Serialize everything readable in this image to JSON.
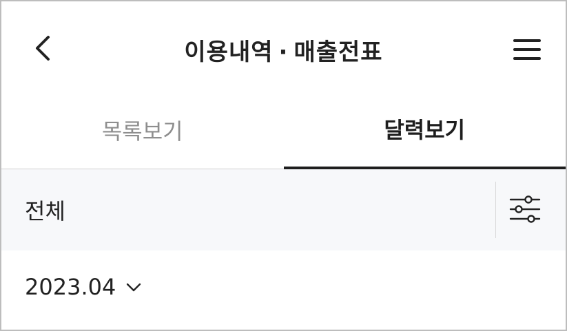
{
  "header": {
    "title_left": "이용내역",
    "title_separator": "·",
    "title_right": "매출전표",
    "back_icon": "chevron-left-icon",
    "menu_icon": "hamburger-menu-icon"
  },
  "tabs": [
    {
      "label": "목록보기",
      "active": false
    },
    {
      "label": "달력보기",
      "active": true
    }
  ],
  "filter": {
    "label": "전체",
    "filter_icon": "sliders-icon"
  },
  "month": {
    "value": "2023.04",
    "icon": "chevron-down-icon"
  },
  "colors": {
    "text": "#222222",
    "inactive_tab": "#8e8e8e",
    "filter_bg": "#f7f8fa",
    "border": "#bdbdbd"
  }
}
